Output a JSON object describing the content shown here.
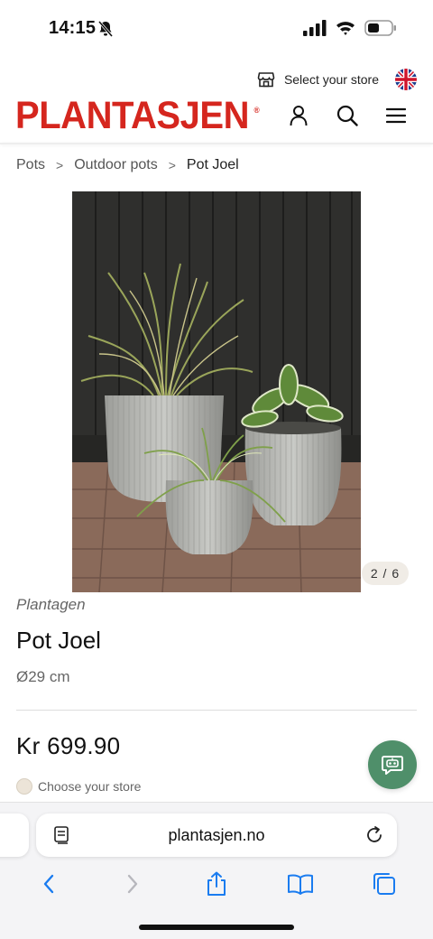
{
  "status_bar": {
    "time": "14:15"
  },
  "header": {
    "store_label": "Select your store",
    "logo": "PLANTASJEN",
    "logo_reg": "®",
    "colors": {
      "brand_red": "#d5261e",
      "accent_green": "#4f8f6a"
    }
  },
  "icons": [
    "store-icon",
    "uk-flag-icon",
    "user-icon",
    "search-icon",
    "menu-icon",
    "chat-bot-icon",
    "reader-icon",
    "reload-icon",
    "back-icon",
    "forward-icon",
    "share-icon",
    "bookmarks-icon",
    "tabs-icon"
  ],
  "breadcrumb": {
    "items": [
      "Pots",
      "Outdoor pots",
      "Pot Joel"
    ],
    "separator": ">"
  },
  "gallery": {
    "counter": "2 / 6",
    "current": 2,
    "total": 6
  },
  "product": {
    "brand": "Plantagen",
    "title": "Pot Joel",
    "size": "Ø29 cm",
    "price": "Kr 699.90",
    "store_prompt": "Choose your store"
  },
  "browser": {
    "url": "plantasjen.no"
  }
}
